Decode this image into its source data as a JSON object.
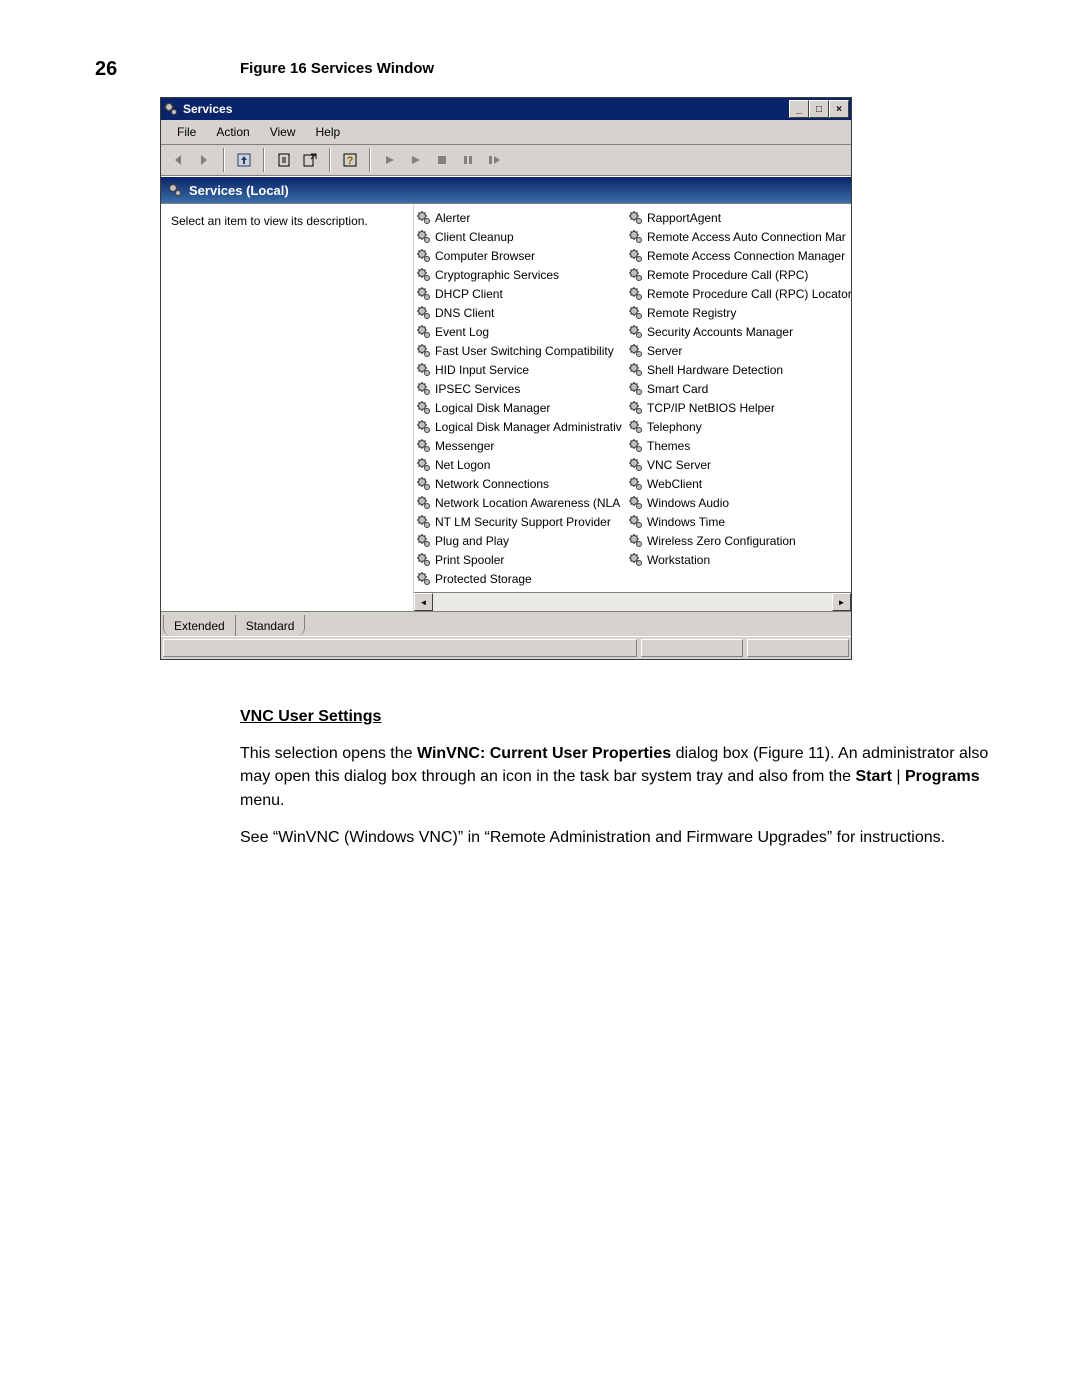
{
  "page_number": "26",
  "figure_caption": "Figure 16    Services Window",
  "window": {
    "title": "Services",
    "menu": [
      "File",
      "Action",
      "View",
      "Help"
    ],
    "header": "Services (Local)",
    "description_hint": "Select an item to view its description.",
    "tabs": [
      "Extended",
      "Standard"
    ],
    "services_left": [
      "Alerter",
      "Client Cleanup",
      "Computer Browser",
      "Cryptographic Services",
      "DHCP Client",
      "DNS Client",
      "Event Log",
      "Fast User Switching Compatibility",
      "HID Input Service",
      "IPSEC Services",
      "Logical Disk Manager",
      "Logical Disk Manager Administrativ",
      "Messenger",
      "Net Logon",
      "Network Connections",
      "Network Location Awareness (NLA",
      "NT LM Security Support Provider",
      "Plug and Play",
      "Print Spooler",
      "Protected Storage"
    ],
    "services_right": [
      "RapportAgent",
      "Remote Access Auto Connection Mar",
      "Remote Access Connection Manager",
      "Remote Procedure Call (RPC)",
      "Remote Procedure Call (RPC) Locator",
      "Remote Registry",
      "Security Accounts Manager",
      "Server",
      "Shell Hardware Detection",
      "Smart Card",
      "TCP/IP NetBIOS Helper",
      "Telephony",
      "Themes",
      "VNC Server",
      "WebClient",
      "Windows Audio",
      "Windows Time",
      "Wireless Zero Configuration",
      "Workstation"
    ]
  },
  "section": {
    "heading": "VNC User Settings",
    "p1a": "This selection opens the ",
    "p1b": "WinVNC: Current User Properties",
    "p1c": " dialog box (Figure 11). An administrator also may open this dialog box through an icon in the task bar system tray and also from the ",
    "p1d": "Start",
    "p1e": " | ",
    "p1f": "Programs",
    "p1g": " menu.",
    "p2": "See “WinVNC (Windows VNC)” in “Remote Administration and Firmware Upgrades” for instructions."
  }
}
